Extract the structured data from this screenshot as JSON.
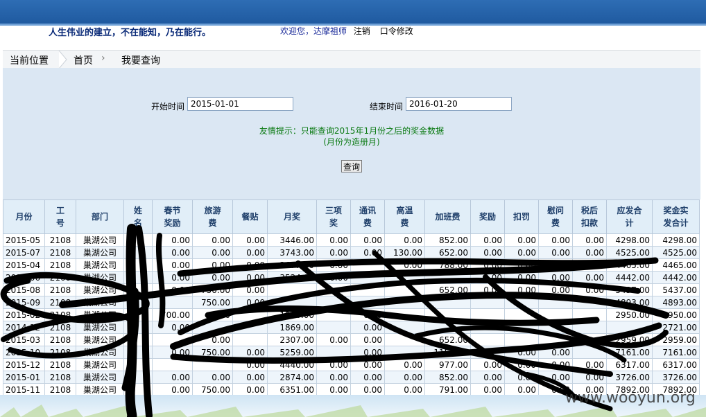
{
  "header": {
    "slogan": "人生伟业的建立，不在能知，乃在能行。",
    "welcome": "欢迎您，达摩祖师",
    "logout": "注销",
    "change_pwd": "口令修改"
  },
  "breadcrumb": {
    "current_label": "当前位置",
    "home": "首页",
    "page": "我要查询"
  },
  "query": {
    "start_label": "开始时间",
    "start_value": "2015-01-01",
    "end_label": "结束时间",
    "end_value": "2016-01-20",
    "tip_line1": "友情提示：只能查询2015年1月份之后的奖金数据",
    "tip_line2": "(月份为造册月)",
    "submit": "查询"
  },
  "table": {
    "headers": [
      "月份",
      "工号",
      "部门",
      "姓名",
      "春节奖励",
      "旅游费",
      "餐贴",
      "月奖",
      "三项奖",
      "通讯费",
      "高温费",
      "加班费",
      "奖励",
      "扣罚",
      "慰问费",
      "税后扣款",
      "应发合计",
      "奖金实发合计"
    ],
    "header_lines": [
      [
        "月份"
      ],
      [
        "工",
        "号"
      ],
      [
        "部门"
      ],
      [
        "姓",
        "名"
      ],
      [
        "春节",
        "奖励"
      ],
      [
        "旅游",
        "费"
      ],
      [
        "餐贴"
      ],
      [
        "月奖"
      ],
      [
        "三项",
        "奖"
      ],
      [
        "通讯",
        "费"
      ],
      [
        "高温",
        "费"
      ],
      [
        "加班费"
      ],
      [
        "奖励"
      ],
      [
        "扣罚"
      ],
      [
        "慰问",
        "费"
      ],
      [
        "税后",
        "扣款"
      ],
      [
        "应发合",
        "计"
      ],
      [
        "奖金实",
        "发合计"
      ]
    ],
    "rows": [
      [
        "2015-05",
        "2108",
        "巢湖公司",
        "",
        "0.00",
        "0.00",
        "0.00",
        "3446.00",
        "0.00",
        "0.00",
        "0.00",
        "852.00",
        "0.00",
        "0.00",
        "0.00",
        "0.00",
        "4298.00",
        "4298.00"
      ],
      [
        "2015-07",
        "2108",
        "巢湖公司",
        "",
        "0.00",
        "0.00",
        "0.00",
        "3743.00",
        "0.00",
        "0.00",
        "130.00",
        "652.00",
        "0.00",
        "0.00",
        "0.00",
        "0.00",
        "4525.00",
        "4525.00"
      ],
      [
        "2015-04",
        "2108",
        "巢湖公司",
        "",
        "0.00",
        "0.00",
        "0.00",
        "3677.00",
        "0.00",
        "",
        "0.00",
        "788.00",
        "0.00",
        "0.00",
        "0.00",
        "0.00",
        "4465.00",
        "4465.00"
      ],
      [
        "2015-06",
        "2108",
        "巢湖公司",
        "",
        "0.00",
        "0.00",
        "0.00",
        "3524.00",
        "0.00",
        "",
        "",
        "",
        "0.00",
        "0.00",
        "0.00",
        "0.00",
        "4442.00",
        "4442.00"
      ],
      [
        "2015-08",
        "2108",
        "巢湖公司",
        "",
        "0.00",
        "750.00",
        "0.00",
        "",
        "",
        "",
        "",
        "652.00",
        "0.00",
        "0.00",
        "0.00",
        "0.00",
        "5437.00",
        "5437.00"
      ],
      [
        "2015-09",
        "2108",
        "巢湖公司",
        "",
        "",
        "750.00",
        "0.00",
        "",
        "",
        "",
        "",
        "",
        "",
        "",
        "",
        "",
        "4893.00",
        "4893.00"
      ],
      [
        "2015-02",
        "2108",
        "巢湖公司",
        "",
        "700.00",
        "0.00",
        "",
        "1290.00",
        "",
        "0.00",
        "",
        "",
        "",
        "",
        "",
        "",
        "2950.00",
        "2950.00"
      ],
      [
        "2014-12",
        "2108",
        "巢湖公司",
        "",
        "0.00",
        "",
        "",
        "1869.00",
        "",
        "0.00",
        "",
        "",
        "",
        "",
        "",
        "",
        "",
        "2721.00"
      ],
      [
        "2015-03",
        "2108",
        "巢湖公司",
        "",
        "",
        "0.00",
        "",
        "2307.00",
        "0.00",
        "0.00",
        "",
        "652.00",
        "",
        "",
        "",
        "",
        "2959.00",
        "2959.00"
      ],
      [
        "2015-10",
        "2108",
        "巢湖公司",
        "",
        "0.00",
        "750.00",
        "0.00",
        "5259.00",
        "",
        "0.00",
        "",
        "1152.00",
        "",
        "0.00",
        "0.00",
        "",
        "7161.00",
        "7161.00"
      ],
      [
        "2015-12",
        "2108",
        "巢湖公司",
        "",
        "",
        "",
        "0.00",
        "4440.00",
        "0.00",
        "0.00",
        "0.00",
        "977.00",
        "0.00",
        "0.00",
        "0.00",
        "0.00",
        "6317.00",
        "6317.00"
      ],
      [
        "2015-01",
        "2108",
        "巢湖公司",
        "",
        "0.00",
        "0.00",
        "0.00",
        "2874.00",
        "0.00",
        "0.00",
        "0.00",
        "852.00",
        "0.00",
        "0.00",
        "0.00",
        "0.00",
        "3726.00",
        "3726.00"
      ],
      [
        "2015-11",
        "2108",
        "巢湖公司",
        "",
        "0.00",
        "750.00",
        "0.00",
        "6351.00",
        "0.00",
        "0.00",
        "0.00",
        "791.00",
        "0.00",
        "0.00",
        "0.00",
        "0.00",
        "7892.00",
        "7892.00"
      ]
    ]
  },
  "watermark": "www.wooyun.org"
}
